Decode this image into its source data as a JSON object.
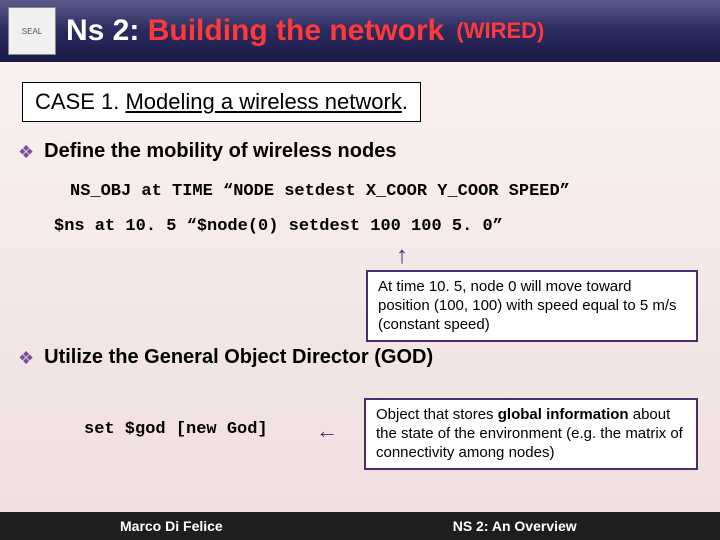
{
  "header": {
    "title_prefix": "Ns 2: ",
    "title_main": "Building the network",
    "tag": "(WIRED)"
  },
  "case": {
    "label": "CASE 1. ",
    "text": "Modeling a wireless network",
    "suffix": "."
  },
  "bullet1": {
    "text": "Define the mobility of wireless nodes"
  },
  "code": {
    "line1": "NS_OBJ at TIME “NODE setdest X_COOR Y_COOR SPEED”",
    "line2": "$ns at 10. 5 “$node(0) setdest 100 100 5. 0”"
  },
  "callout1": {
    "text": "At time 10. 5, node 0 will move toward position (100, 100) with speed equal to 5 m/s (constant speed)"
  },
  "bullet2": {
    "text": "Utilize the General Object Director (GOD)"
  },
  "code3": {
    "text": "set $god [new God]"
  },
  "callout2": {
    "pre": "Object that stores ",
    "bold": "global information",
    "post": " about the state of the environment (e.g. the matrix of connectivity among nodes)"
  },
  "footer": {
    "left": "Marco Di Felice",
    "right": "NS 2: An Overview"
  }
}
